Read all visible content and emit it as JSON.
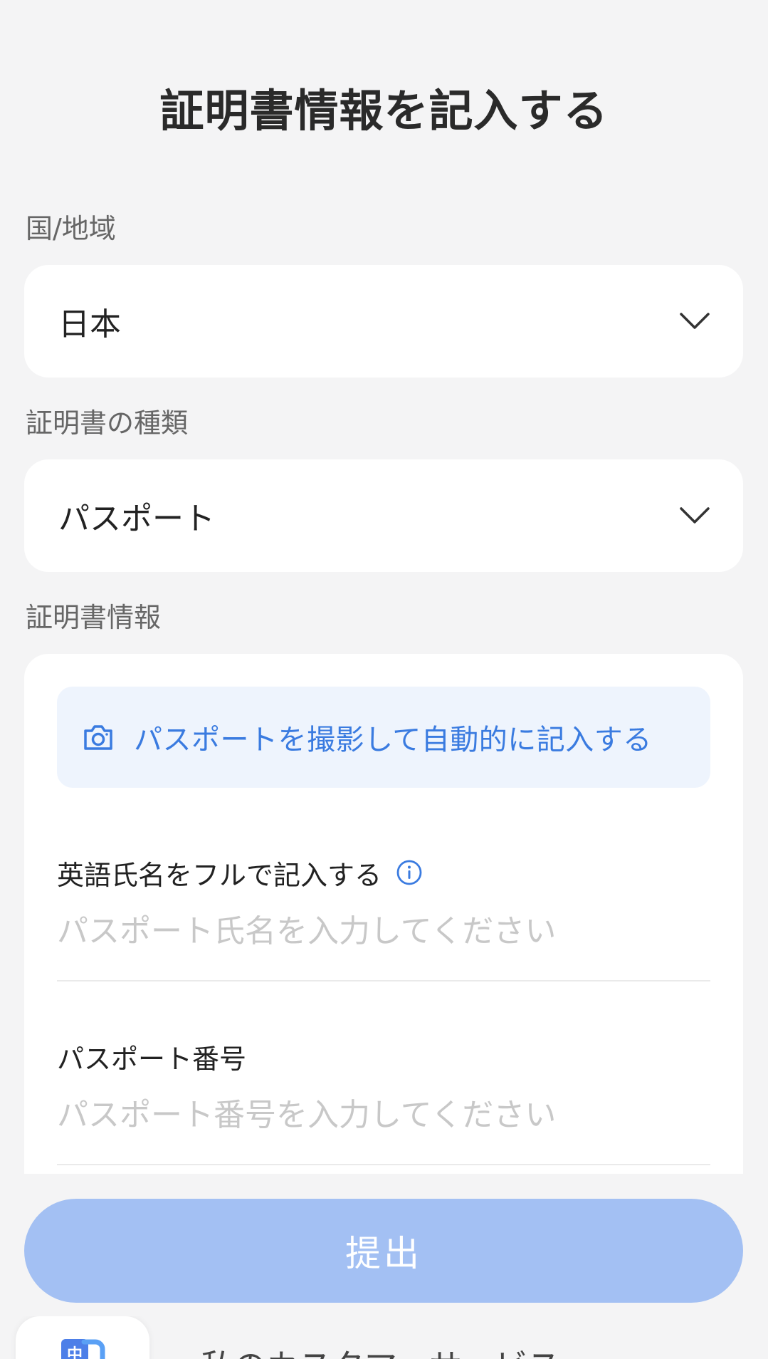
{
  "header": {
    "title": "証明書情報を記入する"
  },
  "region": {
    "label": "国/地域",
    "value": "日本",
    "icon": "chevron-down-icon"
  },
  "doc_type": {
    "label": "証明書の種類",
    "value": "パスポート",
    "icon": "chevron-down-icon"
  },
  "doc_info": {
    "label": "証明書情報",
    "scan_button": {
      "label": "パスポートを撮影して自動的に記入する",
      "icon": "camera-icon"
    },
    "name_field": {
      "label": "英語氏名をフルで記入する",
      "placeholder": "パスポート氏名を入力してください",
      "value": "",
      "info_icon": "info-icon"
    },
    "number_field": {
      "label": "パスポート番号",
      "placeholder": "パスポート番号を入力してください",
      "value": ""
    }
  },
  "submit": {
    "label": "提出"
  },
  "customer_service": {
    "label": "私のカスタマーサービス",
    "icon": "translate-app-icon"
  },
  "colors": {
    "background": "#f4f4f5",
    "card": "#ffffff",
    "accent": "#3a7be0",
    "scan_bg": "#eef4fd",
    "submit_disabled": "#a3c0f3",
    "placeholder": "#c8c8c8"
  }
}
